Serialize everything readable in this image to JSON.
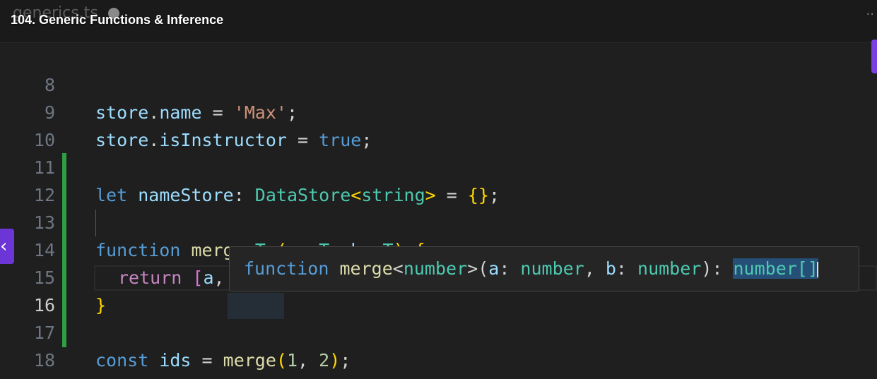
{
  "tab": {
    "filename": "generics.ts",
    "more": "··"
  },
  "video": {
    "title": "104. Generic Functions & Inference"
  },
  "editor": {
    "active_line": "16",
    "line_numbers": [
      "8",
      "9",
      "10",
      "11",
      "12",
      "13",
      "14",
      "15",
      "16",
      "17",
      "18"
    ],
    "lines": {
      "l8": [
        "store",
        ".",
        "name",
        " = ",
        "'Max'",
        ";"
      ],
      "l9": [
        "store",
        ".",
        "isInstructor",
        " = ",
        "true",
        ";"
      ],
      "l11": [
        "let",
        " ",
        "nameStore",
        ": ",
        "DataStore",
        "<",
        "string",
        ">",
        " = ",
        "{}",
        ";"
      ],
      "l13": [
        "function",
        " ",
        "merge",
        "<",
        "T",
        ">",
        "(",
        "a",
        ": ",
        "T",
        ", ",
        "b",
        ": ",
        "T",
        ")",
        " ",
        "{"
      ],
      "l14": [
        "return",
        " ",
        "[",
        "a",
        ", ",
        "b",
        "]",
        ";"
      ],
      "l15": [
        "}"
      ],
      "l17": [
        "const",
        " ",
        "ids",
        " = ",
        "merge",
        "(",
        "1",
        ", ",
        "2",
        ")",
        ";"
      ]
    }
  },
  "hover": {
    "parts": [
      "function",
      " ",
      "merge",
      "<",
      "number",
      ">",
      "(",
      "a",
      ": ",
      "number",
      ", ",
      "b",
      ": ",
      "number",
      "): ",
      "number[]"
    ]
  },
  "controls": {
    "prev_icon": "chevron-left-icon",
    "prev_glyph": "‹"
  },
  "colors": {
    "git_added": "#2ea043",
    "accent": "#6c35d6"
  }
}
